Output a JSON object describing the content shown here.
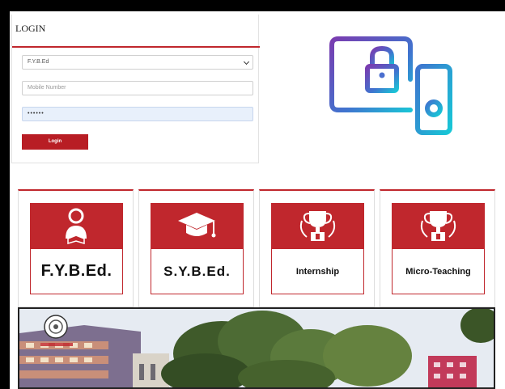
{
  "login": {
    "title": "LOGIN",
    "course_select": {
      "selected": "F.Y.B.Ed"
    },
    "mobile_input": {
      "placeholder": "Mobile Number"
    },
    "password_input": {
      "value": "••••••"
    },
    "submit_label": "Login"
  },
  "courses": [
    {
      "label": "F.Y.B.Ed.",
      "icon": "reader-icon"
    },
    {
      "label": "S.Y.B.Ed.",
      "icon": "graduation-cap-icon"
    },
    {
      "label": "Internship",
      "icon": "trophy-icon"
    },
    {
      "label": "Micro-Teaching",
      "icon": "trophy-icon"
    }
  ],
  "colors": {
    "accent": "#c0272d",
    "illustration_gradient": [
      "#6a3aa8",
      "#3b7fd1",
      "#1ec6d8"
    ]
  }
}
